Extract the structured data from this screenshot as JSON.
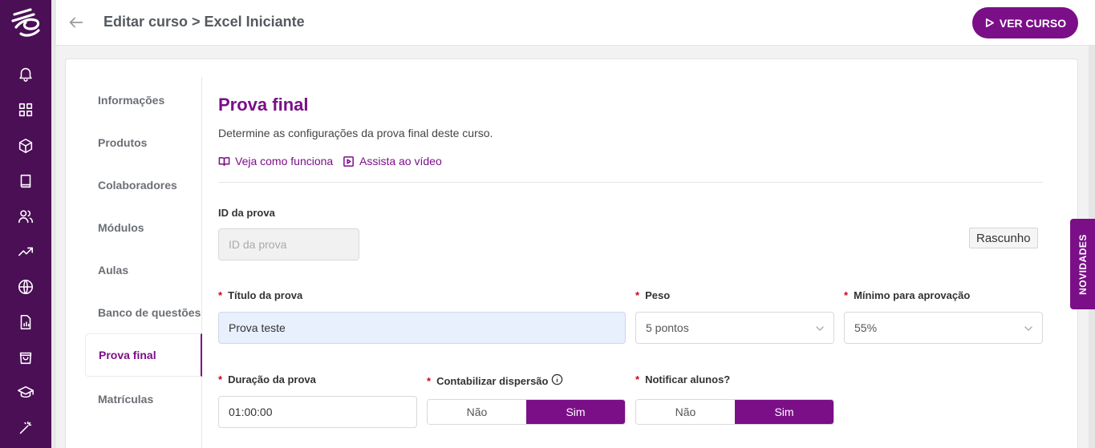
{
  "header": {
    "title": "Editar curso > Excel Iniciante",
    "view_course_label": "VER CURSO"
  },
  "rail": {
    "icons": [
      "logo-icon",
      "bell-icon",
      "grid-icon",
      "box-icon",
      "book-icon",
      "users-icon",
      "trending-up-icon",
      "globe-icon",
      "report-icon",
      "shopping-bag-icon",
      "graduation-cap-icon",
      "magic-wand-icon"
    ]
  },
  "subnav": {
    "items": [
      {
        "label": "Informações"
      },
      {
        "label": "Produtos"
      },
      {
        "label": "Colaboradores"
      },
      {
        "label": "Módulos"
      },
      {
        "label": "Aulas"
      },
      {
        "label": "Banco de questões"
      },
      {
        "label": "Prova final"
      },
      {
        "label": "Matrículas"
      }
    ],
    "active": "Prova final"
  },
  "main": {
    "title": "Prova final",
    "description": "Determine as configurações da prova final deste curso.",
    "links": {
      "how_it_works": "Veja como funciona",
      "watch_video": "Assista ao vídeo"
    },
    "status_badge": "Rascunho",
    "fields": {
      "exam_id": {
        "label": "ID da prova",
        "placeholder": "ID da prova",
        "value": ""
      },
      "exam_title": {
        "label": "Título da prova",
        "value": "Prova teste",
        "required": true
      },
      "weight": {
        "label": "Peso",
        "value": "5 pontos",
        "required": true
      },
      "min_pass": {
        "label": "Mínimo para aprovação",
        "value": "55%",
        "required": true
      },
      "duration": {
        "label": "Duração da prova",
        "value": "01:00:00",
        "required": true
      },
      "count_dispersion": {
        "label": "Contabilizar dispersão",
        "options": [
          "Não",
          "Sim"
        ],
        "selected": "Sim",
        "required": true
      },
      "notify_students": {
        "label": "Notificar alunos?",
        "options": [
          "Não",
          "Sim"
        ],
        "selected": "Sim",
        "required": true
      }
    },
    "required_mark": "*"
  },
  "side_tab": {
    "label": "NOVIDADES"
  },
  "colors": {
    "rail_bg": "#4a0f55",
    "accent": "#7b0f88",
    "required": "#d0021b"
  }
}
